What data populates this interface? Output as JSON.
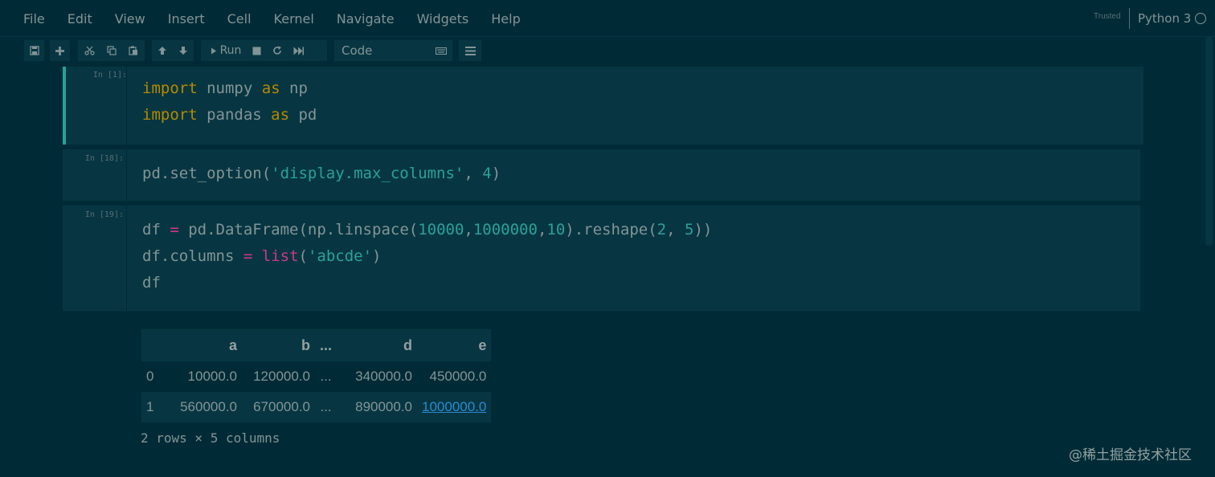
{
  "menubar": {
    "items": [
      "File",
      "Edit",
      "View",
      "Insert",
      "Cell",
      "Kernel",
      "Navigate",
      "Widgets",
      "Help"
    ],
    "trusted": "Trusted",
    "kernel_name": "Python 3"
  },
  "toolbar": {
    "run_label": "Run",
    "cell_type": "Code",
    "icons": [
      "save-icon",
      "plus-icon",
      "cut-icon",
      "copy-icon",
      "paste-icon",
      "arrow-up-icon",
      "arrow-down-icon",
      "play-icon",
      "stop-icon",
      "restart-icon",
      "fast-forward-icon",
      "keyboard-icon",
      "list-icon"
    ]
  },
  "cells": [
    {
      "prompt": "In [1]:"
    },
    {
      "prompt": "In [18]:"
    },
    {
      "prompt": "In [19]:"
    }
  ],
  "code": {
    "c1_l1_kw": "import",
    "c1_l1_mod": " numpy ",
    "c1_l1_as": "as",
    "c1_l1_alias": " np",
    "c1_l2_kw": "import",
    "c1_l2_mod": " pandas ",
    "c1_l2_as": "as",
    "c1_l2_alias": " pd",
    "c2_a": "pd.set_option(",
    "c2_str": "'display.max_columns'",
    "c2_b": ", ",
    "c2_num": "4",
    "c2_c": ")",
    "c3_l1_a": "df ",
    "c3_l1_eq": "=",
    "c3_l1_b": " pd.DataFrame(np.linspace(",
    "c3_l1_n1": "10000",
    "c3_l1_c1": ",",
    "c3_l1_n2": "1000000",
    "c3_l1_c2": ",",
    "c3_l1_n3": "10",
    "c3_l1_c": ").reshape(",
    "c3_l1_n4": "2",
    "c3_l1_d": ", ",
    "c3_l1_n5": "5",
    "c3_l1_e": "))",
    "c3_l2_a": "df.columns ",
    "c3_l2_eq": "=",
    "c3_l2_sp": " ",
    "c3_l2_fn": "list",
    "c3_l2_b": "(",
    "c3_l2_str": "'abcde'",
    "c3_l2_c": ")",
    "c3_l3": "df"
  },
  "output": {
    "columns": [
      "",
      "a",
      "b",
      "...",
      "d",
      "e"
    ],
    "rows": [
      [
        "0",
        "10000.0",
        "120000.0",
        "...",
        "340000.0",
        "450000.0"
      ],
      [
        "1",
        "560000.0",
        "670000.0",
        "...",
        "890000.0",
        "1000000.0"
      ]
    ],
    "summary": "2 rows × 5 columns"
  },
  "watermark": "@稀土掘金技术社区",
  "colors": {
    "background": "#002b36",
    "cell_bg": "#073642",
    "keyword": "#b58900",
    "operator": "#d33682",
    "number": "#2aa198",
    "link": "#268bd2"
  }
}
